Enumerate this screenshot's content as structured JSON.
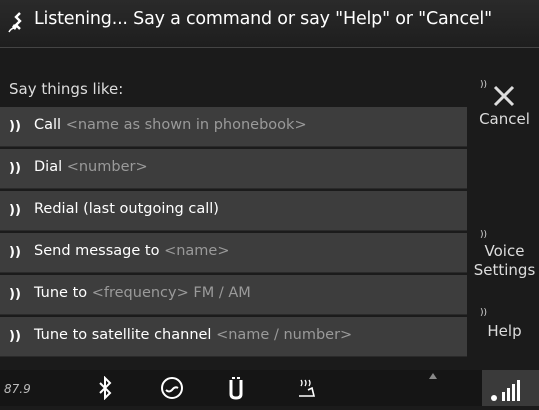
{
  "header": {
    "title": "Listening... Say a command or say \"Help\" or \"Cancel\""
  },
  "prompt": "Say things like:",
  "commands": [
    {
      "command": "Call",
      "hint": "<name as shown in phonebook>"
    },
    {
      "command": "Dial",
      "hint": "<number>"
    },
    {
      "command": "Redial (last outgoing call)",
      "hint": ""
    },
    {
      "command": "Send message to",
      "hint": "<name>"
    },
    {
      "command": "Tune to",
      "hint": "<frequency> FM / AM"
    },
    {
      "command": "Tune to satellite channel",
      "hint": "<name / number>"
    }
  ],
  "side": {
    "cancel": "Cancel",
    "voice_line1": "Voice",
    "voice_line2": "Settings",
    "help": "Help"
  },
  "bottom": {
    "frequency": "87.9"
  },
  "icons": {
    "speaker": "speaker-icon",
    "mic": "microphone-icon",
    "bluetooth": "bluetooth-icon",
    "signal": "signal-strength-icon"
  },
  "colors": {
    "background": "#1b1b1b",
    "row": "#3d3d3d",
    "hint": "#9a9a9a"
  }
}
